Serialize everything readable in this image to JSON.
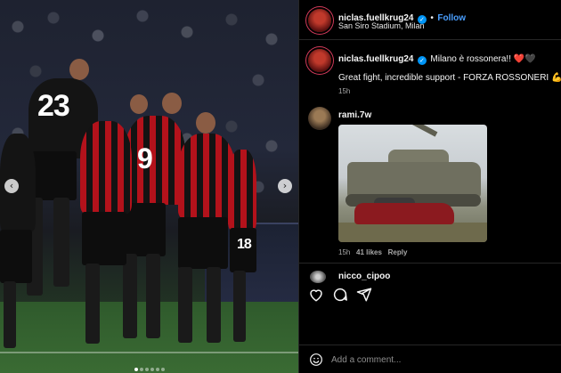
{
  "post": {
    "header": {
      "username": "niclas.fuellkrug24",
      "separator": "•",
      "follow_label": "Follow",
      "location": "San Siro Stadium, Milan"
    },
    "caption": {
      "username": "niclas.fuellkrug24",
      "text_line1": "Milano è rossonera!! ❤️🖤",
      "text_line2": "Great fight, incredible support - FORZA ROSSONERI 💪🔥",
      "time": "15h"
    },
    "photo": {
      "player_numbers": [
        "23",
        "9",
        "18"
      ],
      "carousel_count": 6,
      "carousel_active_index": 0
    }
  },
  "comments": [
    {
      "username": "rami.7w",
      "time": "15h",
      "likes": "41 likes",
      "reply_label": "Reply"
    },
    {
      "username": "nicco_cipoo"
    }
  ],
  "comment_box": {
    "placeholder": "Add a comment..."
  },
  "colors": {
    "follow": "#4a9fff",
    "verified": "#0095f6",
    "milan_red": "#b3121b"
  },
  "icons": {
    "prev": "chevron-left-icon",
    "next": "chevron-right-icon",
    "like": "heart-icon",
    "comment": "comment-icon",
    "share": "share-icon",
    "emoji": "smiley-icon"
  }
}
